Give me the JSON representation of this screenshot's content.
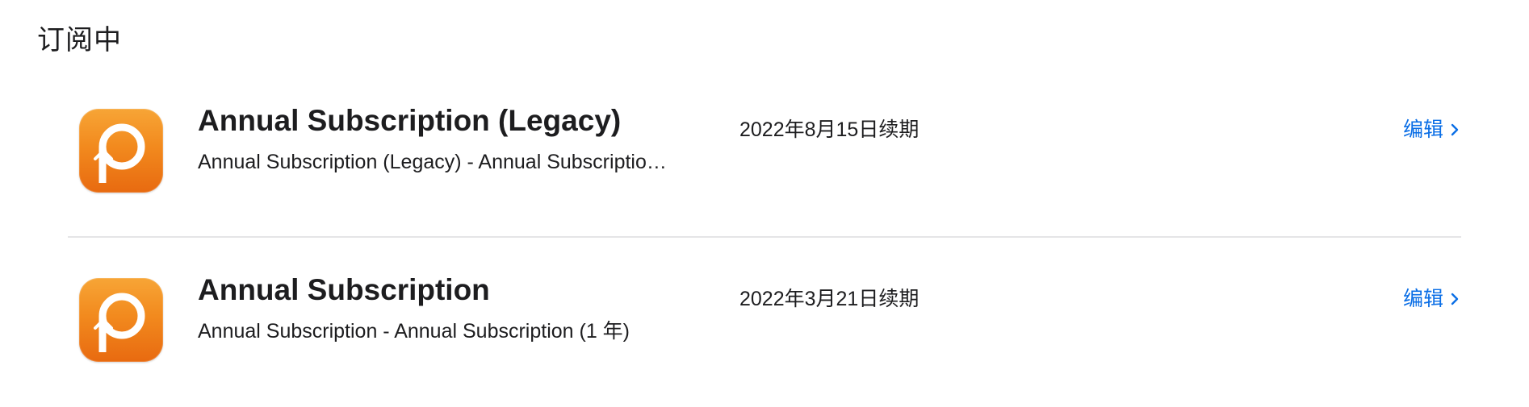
{
  "section": {
    "title": "订阅中"
  },
  "subscriptions": [
    {
      "name": "Annual Subscription (Legacy)",
      "description": "Annual Subscription (Legacy) - Annual Subscriptio…",
      "renewal": "2022年8月15日续期",
      "edit_label": "编辑",
      "icon": "app-icon"
    },
    {
      "name": "Annual Subscription",
      "description": "Annual Subscription - Annual Subscription (1 年)",
      "renewal": "2022年3月21日续期",
      "edit_label": "编辑",
      "icon": "app-icon"
    }
  ],
  "colors": {
    "accent": "#0a6ee6",
    "icon_orange_top": "#f7a536",
    "icon_orange_bottom": "#e86a10",
    "divider": "#e5e5e7"
  }
}
